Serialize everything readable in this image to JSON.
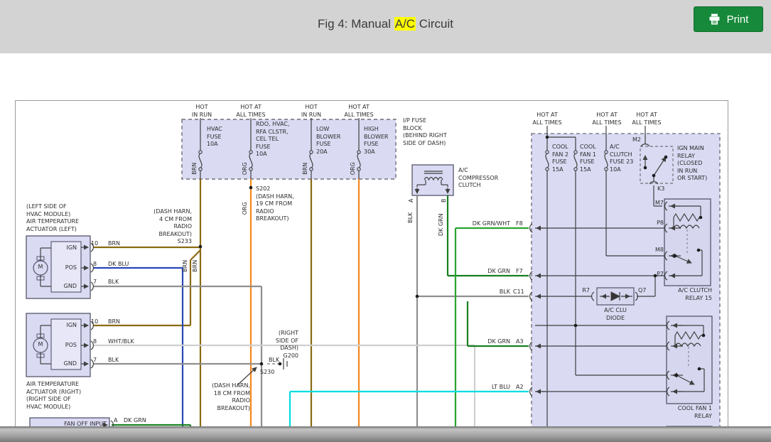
{
  "header": {
    "title_prefix": "Fig 4: Manual ",
    "title_highlight": "A/C",
    "title_suffix": " Circuit",
    "print_label": "Print"
  },
  "colors": {
    "header_bg": "#d3d3d3",
    "print_green": "#17893a",
    "highlight_yellow": "#ffff00",
    "box_fill": "#dadaf3",
    "box_fill_inner": "#e7e7f8",
    "relay_fill": "#d6d6ef",
    "box_stroke": "#55556a",
    "dashed_stroke": "#80808c",
    "line": "#3f3f3f",
    "frame": "#9a9a9a",
    "wire": {
      "brn": "#8a6a12",
      "org": "#f5871d",
      "dk_blu": "#2846b6",
      "blk": "#8f8f8f",
      "wht_blk": "#cfcfcf",
      "dk_grn": "#168020",
      "dk_grn_wht": "#2ba32f",
      "lt_blu": "#00dde2"
    }
  },
  "labels": {
    "hot_in_run_1": "HOT\nIN RUN",
    "hot_all_times_1": "HOT AT\nALL TIMES",
    "hot_in_run_2": "HOT\nIN RUN",
    "hot_all_times_2": "HOT AT\nALL TIMES",
    "fuse_hvac": "HVAC\nFUSE\n10A",
    "fuse_rdo": "RDO, HVAC,\nRFA CLSTR,\nCEL TEL\nFUSE\n10A",
    "fuse_low_blower": "LOW\nBLOWER\nFUSE\n20A",
    "fuse_high_blower": "HIGH\nBLOWER\nFUSE\n30A",
    "ip_fuse_block": "I/P FUSE\nBLOCK\n(BEHIND RIGHT\nSIDE OF DASH)",
    "ac_compressor_clutch": "A/C\nCOMPRESSOR\nCLUTCH",
    "hot_all_times_3": "HOT AT\nALL TIMES",
    "hot_all_times_4": "HOT AT\nALL TIMES",
    "hot_all_times_5": "HOT AT\nALL TIMES",
    "fuse_cool_fan2": "COOL\nFAN 2\nFUSE\n15A",
    "fuse_cool_fan1": "COOL\nFAN 1\nFUSE\n15A",
    "fuse_ac_clutch": "A/C\nCLUTCH\nFUSE 23\n10A",
    "m2": "M2",
    "k3": "K3",
    "ign_main_relay": "IGN MAIN\nRELAY\n(CLOSED\nIN RUN\nOR START)",
    "m7": "M7",
    "p8": "P8",
    "m8": "M8",
    "p7": "P7",
    "ac_clutch_relay": "A/C CLUTCH\nRELAY 15",
    "r7": "R7",
    "q7": "Q7",
    "ac_clu_diode": "A/C CLU\nDIODE",
    "w_dk_grn_wht": "DK GRN/WHT",
    "f8": "F8",
    "w_dk_grn_f7": "DK GRN",
    "f7": "F7",
    "w_blk_c11": "BLK",
    "c11": "C11",
    "w_dk_grn_a3": "DK GRN",
    "a3": "A3",
    "w_lt_blu": "LT BLU",
    "a2": "A2",
    "cool_fan1_relay": "COOL FAN 1\nRELAY",
    "act_left": "(LEFT SIDE OF\nHVAC MODULE)\nAIR TEMPERATURE\nACTUATOR (LEFT)",
    "act_right": "AIR TEMPERATURE\nACTUATOR (RIGHT)\n(RIGHT SIDE OF\nHVAC MODULE)",
    "fan_off_input": "FAN OFF INPUT",
    "ign_1": "IGN",
    "pos_1": "POS",
    "gnd_1": "GND",
    "ign_2": "IGN",
    "pos_2": "POS",
    "gnd_2": "GND",
    "m_1": "M",
    "m_2": "M",
    "pin10_1": "10",
    "brn_1": "BRN",
    "pin8_1": "8",
    "dk_blu_1": "DK BLU",
    "pin7_1": "7",
    "blk_1": "BLK",
    "pin10_2": "10",
    "brn_2": "BRN",
    "pin8_2": "8",
    "wht_blk_2": "WHT/BLK",
    "pin7_2": "7",
    "blk_2": "BLK",
    "pin_a": "A",
    "dk_grn_a": "DK GRN",
    "s233": "(DASH HARN,\n4 CM FROM\nRADIO\nBREAKOUT)\nS233",
    "s202": "S202\n(DASH HARN,\n19 CM FROM\nRADIO\nBREAKOUT)",
    "g200": "(RIGHT\nSIDE OF\nDASH)\nG200",
    "blk_g200": "BLK",
    "s230": "S230",
    "dash_harn_18": "(DASH HARN,\n18 CM FROM\nRADIO\nBREAKOUT)",
    "rot_brn_a": "BRN",
    "rot_org_a": "ORG",
    "rot_brn_b": "BRN",
    "rot_org_b": "ORG",
    "rot_org_c": "ORG",
    "rot_brn_c": "BRN",
    "rot_brn_d": "BRN",
    "rot_a": "A",
    "rot_blk_a": "BLK",
    "rot_b": "B",
    "rot_dk_grn_b": "DK GRN"
  }
}
